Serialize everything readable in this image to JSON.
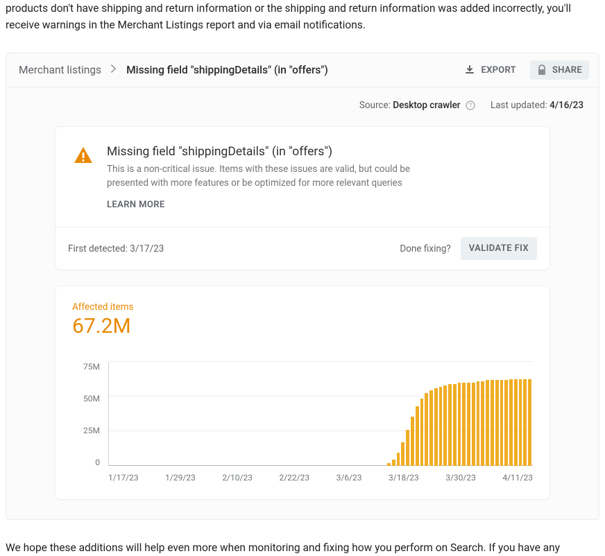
{
  "intro": "products don't have shipping and return information or the shipping and return information was added incorrectly, you'll receive warnings in the Merchant Listings report and via email notifications.",
  "breadcrumb": {
    "root": "Merchant listings",
    "current": "Missing field \"shippingDetails\" (in \"offers\")"
  },
  "actions": {
    "export": "EXPORT",
    "share": "SHARE"
  },
  "meta": {
    "source_label": "Source:",
    "source_value": "Desktop crawler",
    "updated_label": "Last updated:",
    "updated_value": "4/16/23"
  },
  "issue": {
    "title": "Missing field \"shippingDetails\" (in \"offers\")",
    "desc": "This is a non-critical issue. Items with these issues are valid, but could be presented with more features or be optimized for more relevant queries",
    "learn_more": "LEARN MORE",
    "first_detected_label": "First detected:",
    "first_detected_value": "3/17/23",
    "done_fixing": "Done fixing?",
    "validate": "VALIDATE FIX"
  },
  "chart_summary": {
    "label": "Affected items",
    "value": "67.2M"
  },
  "chart_data": {
    "type": "bar",
    "title": "Affected items",
    "ylabel": "",
    "xlabel": "",
    "ylim": [
      0,
      80
    ],
    "y_ticks": [
      "75M",
      "50M",
      "25M",
      "0"
    ],
    "x_ticks": [
      "1/17/23",
      "1/29/23",
      "2/10/23",
      "2/22/23",
      "3/6/23",
      "3/18/23",
      "3/30/23",
      "4/11/23"
    ],
    "categories": [
      "1/17/23",
      "1/18/23",
      "1/19/23",
      "1/20/23",
      "1/21/23",
      "1/22/23",
      "1/23/23",
      "1/24/23",
      "1/25/23",
      "1/26/23",
      "1/27/23",
      "1/28/23",
      "1/29/23",
      "1/30/23",
      "1/31/23",
      "2/1/23",
      "2/2/23",
      "2/3/23",
      "2/4/23",
      "2/5/23",
      "2/6/23",
      "2/7/23",
      "2/8/23",
      "2/9/23",
      "2/10/23",
      "2/11/23",
      "2/12/23",
      "2/13/23",
      "2/14/23",
      "2/15/23",
      "2/16/23",
      "2/17/23",
      "2/18/23",
      "2/19/23",
      "2/20/23",
      "2/21/23",
      "2/22/23",
      "2/23/23",
      "2/24/23",
      "2/25/23",
      "2/26/23",
      "2/27/23",
      "2/28/23",
      "3/1/23",
      "3/2/23",
      "3/3/23",
      "3/4/23",
      "3/5/23",
      "3/6/23",
      "3/7/23",
      "3/8/23",
      "3/9/23",
      "3/10/23",
      "3/11/23",
      "3/12/23",
      "3/13/23",
      "3/14/23",
      "3/15/23",
      "3/16/23",
      "3/17/23",
      "3/18/23",
      "3/19/23",
      "3/20/23",
      "3/21/23",
      "3/22/23",
      "3/23/23",
      "3/24/23",
      "3/25/23",
      "3/26/23",
      "3/27/23",
      "3/28/23",
      "3/29/23",
      "3/30/23",
      "3/31/23",
      "4/1/23",
      "4/2/23",
      "4/3/23",
      "4/4/23",
      "4/5/23",
      "4/6/23",
      "4/7/23",
      "4/8/23",
      "4/9/23",
      "4/10/23",
      "4/11/23",
      "4/12/23",
      "4/13/23",
      "4/14/23",
      "4/15/23",
      "4/16/23"
    ],
    "values": [
      0,
      0,
      0,
      0,
      0,
      0,
      0,
      0,
      0,
      0,
      0,
      0,
      0,
      0,
      0,
      0,
      0,
      0,
      0,
      0,
      0,
      0,
      0,
      0,
      0,
      0,
      0,
      0,
      0,
      0,
      0,
      0,
      0,
      0,
      0,
      0,
      0,
      0,
      0,
      0,
      0,
      0,
      0,
      0,
      0,
      0,
      0,
      0,
      0,
      0,
      0,
      0,
      0,
      0,
      0,
      0,
      0,
      0,
      0,
      2,
      5,
      10,
      18,
      28,
      38,
      46,
      52,
      56,
      58,
      60,
      61,
      62,
      63,
      63,
      64,
      64,
      64,
      64,
      65,
      65,
      66,
      66,
      66,
      66,
      66,
      67,
      67,
      67,
      67,
      67
    ]
  },
  "outro": "We hope these additions will help even more when monitoring and fixing how you perform on Search. If you have any"
}
